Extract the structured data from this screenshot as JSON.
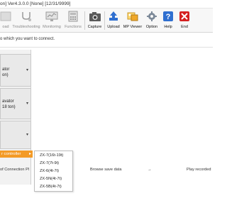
{
  "window": {
    "title": "on] Ver4.3.0.0 [None] [12/31/9999]"
  },
  "toolbar": {
    "items": [
      {
        "label": "oad",
        "icon": "download-icon",
        "enabled": false
      },
      {
        "label": "Troubleshooting",
        "icon": "stethoscope-icon",
        "enabled": false
      },
      {
        "label": "Monitoring",
        "icon": "monitor-icon",
        "enabled": false
      },
      {
        "label": "Functions",
        "icon": "calculator-icon",
        "enabled": false
      },
      {
        "label": "Capture",
        "icon": "camera-icon",
        "enabled": true
      },
      {
        "label": "Upload",
        "icon": "upload-icon",
        "enabled": true
      },
      {
        "label": "MP Viewer",
        "icon": "mp-viewer-icon",
        "enabled": true
      },
      {
        "label": "Option",
        "icon": "gear-icon",
        "enabled": true
      },
      {
        "label": "Help",
        "icon": "help-icon",
        "enabled": true
      },
      {
        "label": "End",
        "icon": "end-icon",
        "enabled": true
      }
    ]
  },
  "main": {
    "hint": "o which you want to connect.",
    "machines": [
      {
        "line1": "ator",
        "line2": "on)"
      },
      {
        "line1": "avator",
        "line2": "18 ton)"
      },
      {
        "line1": "",
        "line2": ""
      }
    ],
    "selected_item": "r controller",
    "submenu": [
      "ZX-7(16t-19t)",
      "ZX-7(7t-9t)",
      "ZX-6(4t-7t)",
      "ZX-5N(4t-7t)",
      "ZX-5B(4t-7t)"
    ],
    "bottom": {
      "connection_label": "of Connection Pl",
      "browse_label": "Browse save data",
      "arrow": "→",
      "play_label": "Play recorded"
    }
  },
  "colors": {
    "accent": "#f39a26",
    "toolbar_bg": "#f7f7f7",
    "panel_bg": "#f2f2f2",
    "icon_red": "#d42020",
    "icon_blue": "#2f6fd0"
  }
}
